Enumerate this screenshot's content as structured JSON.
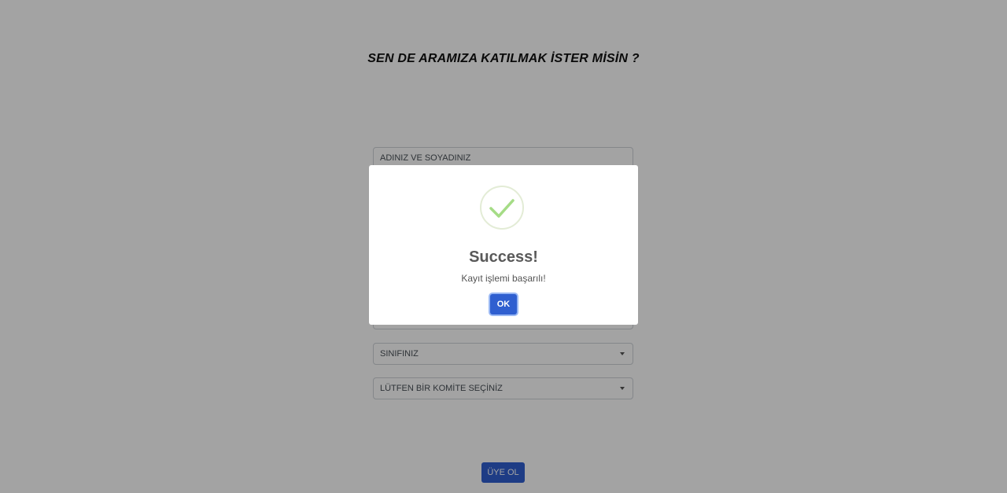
{
  "page": {
    "title": "SEN DE ARAMIZA KATILMAK İSTER MİSİN ?"
  },
  "form": {
    "name_placeholder": "ADINIZ VE SOYADINIZ",
    "class_select": "SINIFINIZ",
    "committee_select": "LÜTFEN BİR KOMİTE SEÇİNİZ",
    "submit_label": "ÜYE OL"
  },
  "modal": {
    "icon": "check-circle-icon",
    "title": "Success!",
    "message": "Kayıt işlemi başarılı!",
    "ok_label": "OK"
  },
  "colors": {
    "accent": "#2f5fd0",
    "success": "#a5dc86",
    "overlay": "rgba(0,0,0,0.36)"
  }
}
